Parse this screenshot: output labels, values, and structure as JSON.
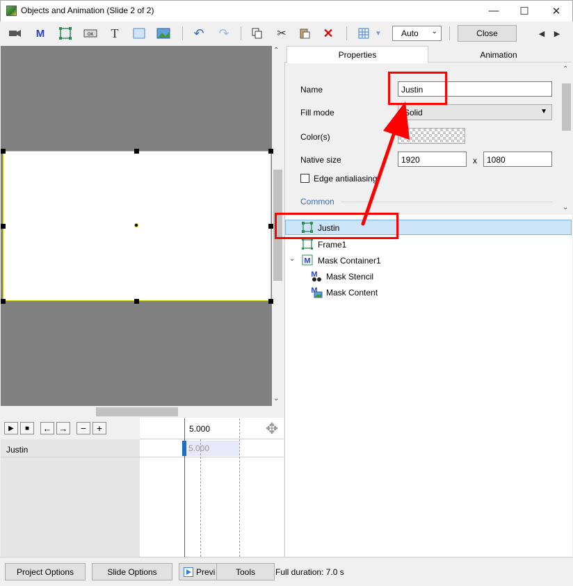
{
  "window": {
    "title": "Objects and Animation (Slide 2 of 2)"
  },
  "toolbar": {
    "zoom_select": "Auto",
    "close_label": "Close"
  },
  "tabs": {
    "properties": "Properties",
    "animation": "Animation"
  },
  "properties": {
    "name_label": "Name",
    "name_value": "Justin",
    "fill_mode_label": "Fill mode",
    "fill_mode_value": "Solid",
    "colors_label": "Color(s)",
    "native_size_label": "Native size",
    "native_width": "1920",
    "native_x": "x",
    "native_height": "1080",
    "edge_antialiasing_label": "Edge antialiasing",
    "edge_antialiasing_checked": false,
    "common_label": "Common"
  },
  "object_tree": {
    "items": [
      {
        "label": "Justin",
        "selected": true,
        "icon": "rectangle-icon"
      },
      {
        "label": "Frame1",
        "selected": false,
        "icon": "frame-icon"
      },
      {
        "label": "Mask Container1",
        "selected": false,
        "icon": "mask-container-icon",
        "expanded": true
      },
      {
        "label": "Mask Stencil",
        "selected": false,
        "icon": "mask-stencil-icon"
      },
      {
        "label": "Mask Content",
        "selected": false,
        "icon": "mask-content-icon"
      }
    ]
  },
  "timeline": {
    "time_label": "5.000",
    "bar_label": "5.000",
    "rows": [
      "Justin"
    ]
  },
  "bottom_bar": {
    "project_options": "Project Options",
    "slide_options": "Slide Options",
    "preview": "Previ",
    "tools": "Tools",
    "duration": "Full duration: 7.0 s"
  },
  "colors": {
    "annotation": "#ff0000",
    "selection_bg": "#cce4f7",
    "canvas_bg": "#808080",
    "object_outline": "#c8d400",
    "timeline_marker": "#1f6dbf"
  }
}
